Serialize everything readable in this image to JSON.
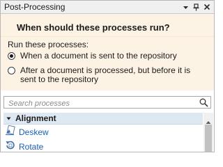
{
  "window": {
    "title": "Post-Processing",
    "buttons": {
      "pin_icon": "pin-icon",
      "close_icon": "close-icon"
    }
  },
  "question": {
    "heading": "When should these processes run?",
    "run_label": "Run these processes:",
    "options": [
      {
        "label": "When a document is sent to the repository",
        "selected": true
      },
      {
        "label": "After a document is processed, but before it is sent to the repository",
        "selected": false
      }
    ]
  },
  "search": {
    "placeholder": "Search processes",
    "value": ""
  },
  "processes": {
    "group_title": "Alignment",
    "items": [
      {
        "label": "Deskew",
        "icon": "deskew-icon"
      },
      {
        "label": "Rotate",
        "icon": "rotate-icon"
      }
    ]
  },
  "colors": {
    "header_bg": "#fdf3e4",
    "group_bg": "#dde8f3",
    "link": "#1a5fb4"
  }
}
